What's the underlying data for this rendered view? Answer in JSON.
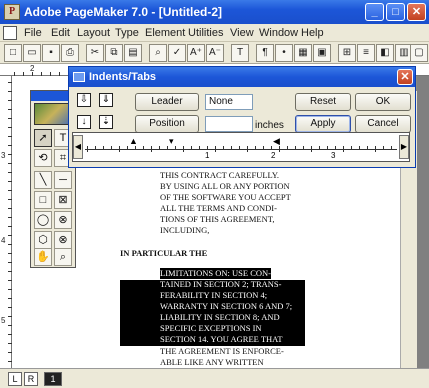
{
  "window": {
    "title": "Adobe PageMaker 7.0 - [Untitled-2]",
    "minimize": "_",
    "maximize": "□",
    "close": "✕"
  },
  "menu": [
    "File",
    "Edit",
    "Layout",
    "Type",
    "Element",
    "Utilities",
    "View",
    "Window",
    "Help"
  ],
  "toolbar_icons": [
    "new-doc-icon",
    "open-icon",
    "save-icon",
    "print-icon",
    "cut-icon",
    "copy-icon",
    "paste-icon",
    "find-icon",
    "spell-icon",
    "font-size-up-icon",
    "font-size-down-icon",
    "text-icon",
    "paragraph-icon",
    "bullet-icon",
    "frame-icon",
    "image-icon",
    "link-icon",
    "layers-icon",
    "colors-icon",
    "styles-icon",
    "page-icon",
    "help-icon"
  ],
  "toolbar_glyphs": [
    "□",
    "▭",
    "▪",
    "⎙",
    "✂",
    "⧉",
    "▤",
    "⌕",
    "✓",
    "A⁺",
    "A⁻",
    "T",
    "¶",
    "•",
    "▦",
    "▣",
    "⊞",
    "≡",
    "◧",
    "▥",
    "▢",
    "?"
  ],
  "dialog": {
    "title": "Indents/Tabs",
    "leader_button": "Leader",
    "leader_value": "None",
    "position_button": "Position",
    "position_value": "",
    "units": "inches",
    "reset_button": "Reset",
    "ok_button": "OK",
    "apply_button": "Apply",
    "cancel_button": "Cancel",
    "ruler_numbers": [
      "1",
      "2",
      "3"
    ]
  },
  "ruler_left_numbers": [
    "3",
    "4",
    "5"
  ],
  "document": {
    "paragraph1": [
      "THIS CONTRACT CAREFULLY.",
      "BY USING ALL OR ANY PORTION",
      "OF THE SOFTWARE YOU ACCEPT",
      "ALL THE TERMS AND CONDI-",
      "TIONS OF THIS AGREEMENT,",
      "INCLUDING,"
    ],
    "heading": "IN PARTICULAR THE",
    "selected_lines": [
      "LIMITATIONS ON: USE CON-",
      "TAINED IN SECTION 2; TRANS-",
      "FERABILITY IN SECTION 4;",
      "WARRANTY IN SECTION 6 AND 7;",
      "LIABILITY IN SECTION 8; AND",
      "SPECIFIC EXCEPTIONS IN",
      "SECTION 14. YOU AGREE THAT"
    ],
    "trailing_lines": [
      "THE AGREEMENT IS ENFORCE-",
      "ABLE LIKE ANY WRITTEN"
    ]
  },
  "status": {
    "left_page": "L",
    "right_page": "R",
    "page_number": "1"
  }
}
